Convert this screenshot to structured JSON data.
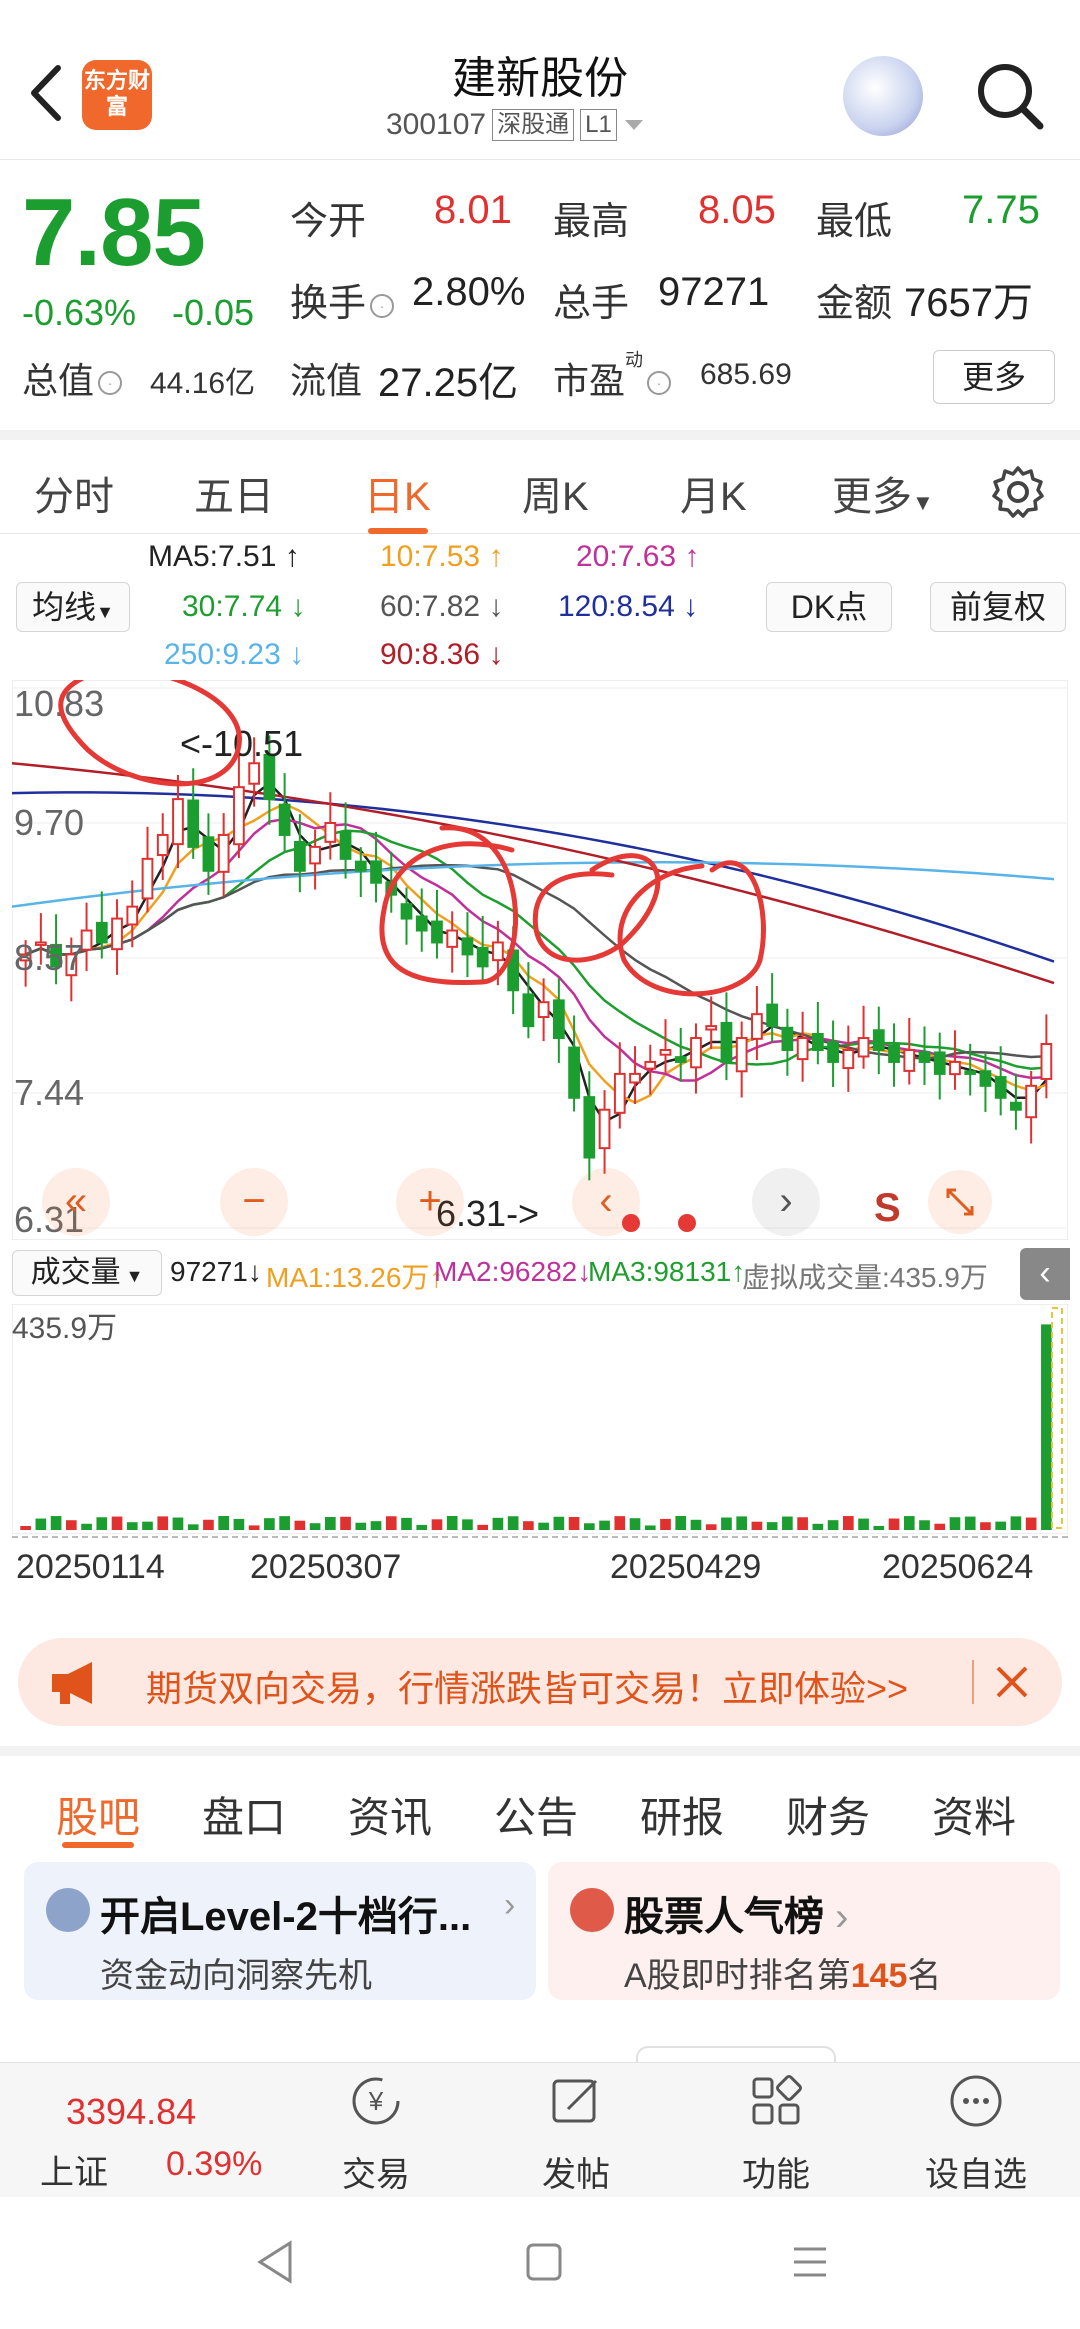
{
  "header": {
    "logo_text": "东方财富",
    "title": "建新股份",
    "code": "300107",
    "tag1": "深股通",
    "tag2": "L1"
  },
  "quote": {
    "price": "7.85",
    "change_pct": "-0.63%",
    "change": "-0.05",
    "open_label": "今开",
    "open": "8.01",
    "high_label": "最高",
    "high": "8.05",
    "low_label": "最低",
    "low": "7.75",
    "turnover_label": "换手",
    "turnover": "2.80%",
    "volume_label": "总手",
    "volume": "97271",
    "amount_label": "金额",
    "amount": "7657万",
    "mktcap_label": "总值",
    "mktcap": "44.16亿",
    "float_label": "流值",
    "float": "27.25亿",
    "pe_label": "市盈",
    "pe_sup": "动",
    "pe": "685.69",
    "more": "更多"
  },
  "tabs": [
    "分时",
    "五日",
    "日K",
    "周K",
    "月K",
    "更多"
  ],
  "active_tab": "日K",
  "ma": {
    "selector": "均线",
    "ma5": "MA5:7.51",
    "ma5_arrow": "↑",
    "ma10": "10:7.53",
    "ma10_arrow": "↑",
    "ma20": "20:7.63",
    "ma20_arrow": "↑",
    "ma30": "30:7.74",
    "ma30_arrow": "↓",
    "ma60": "60:7.82",
    "ma60_arrow": "↓",
    "ma120": "120:8.54",
    "ma120_arrow": "↓",
    "ma250": "250:9.23",
    "ma250_arrow": "↓",
    "ma90": "90:8.36",
    "ma90_arrow": "↓",
    "dk": "DK点",
    "adjust": "前复权",
    "colors": {
      "ma5": "#222222",
      "ma10": "#f0a020",
      "ma20": "#c0309a",
      "ma30": "#1e9e2e",
      "ma60": "#555555",
      "ma120": "#1f2f9c",
      "ma250": "#58b4e8",
      "ma90": "#b21e28"
    }
  },
  "chart_data": [
    {
      "type": "candlestick",
      "y_ticks": [
        "10.83",
        "9.70",
        "8.57",
        "7.44",
        "6.31"
      ],
      "ylim": [
        6.31,
        10.83
      ],
      "max_label": "<-10.51",
      "min_label": "6.31->",
      "close_series": [
        8.6,
        8.7,
        8.5,
        8.6,
        8.8,
        8.7,
        8.9,
        9.0,
        9.4,
        9.6,
        9.9,
        9.5,
        9.3,
        9.6,
        10.0,
        10.2,
        9.9,
        9.6,
        9.3,
        9.5,
        9.7,
        9.4,
        9.3,
        9.2,
        9.1,
        8.9,
        8.8,
        8.7,
        8.8,
        8.6,
        8.5,
        8.7,
        8.3,
        8.0,
        8.2,
        7.9,
        7.4,
        6.9,
        7.3,
        7.6,
        7.6,
        7.7,
        7.8,
        7.7,
        7.9,
        8.0,
        7.7,
        7.9,
        8.1,
        8.0,
        7.8,
        7.9,
        7.8,
        7.7,
        7.8,
        7.9,
        7.8,
        7.7,
        7.8,
        7.7,
        7.6,
        7.7,
        7.6,
        7.5,
        7.4,
        7.3,
        7.5,
        7.85
      ]
    },
    {
      "type": "bar",
      "title": "成交量",
      "vol": "97271",
      "ma1": "MA1:13.26万",
      "ma1_arrow": "↑",
      "ma2": "MA2:96282",
      "ma2_arrow": "↓",
      "ma3": "MA3:98131",
      "ma3_arrow": "↑",
      "virtual": "虚拟成交量:435.9万",
      "y_max_label": "435.9万",
      "dates": [
        "20250114",
        "20250307",
        "20250429",
        "20250624"
      ]
    }
  ],
  "overlay_buttons": {
    "rewind": "«",
    "zoom_out": "−",
    "zoom_in": "+",
    "prev": "‹",
    "next": "›",
    "s": "S"
  },
  "promo": {
    "text": "期货双向交易，行情涨跌皆可交易！立即体验>>"
  },
  "bottom_tabs": [
    "股吧",
    "盘口",
    "资讯",
    "公告",
    "研报",
    "财务",
    "资料"
  ],
  "cards": [
    {
      "title": "开启Level-2十档行...",
      "sub": "资金动向洞察先机"
    },
    {
      "title": "股票人气榜",
      "sub_prefix": "A股即时排名第",
      "rank": "145",
      "sub_suffix": "名"
    }
  ],
  "bottom_nav": {
    "index_value": "3394.84",
    "index_name": "上证",
    "index_pct": "0.39%",
    "items": [
      "交易",
      "发帖",
      "功能",
      "设自选"
    ]
  }
}
